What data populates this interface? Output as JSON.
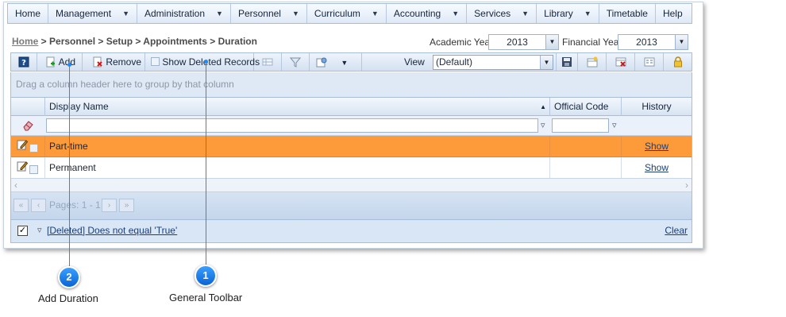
{
  "menu": [
    {
      "label": "Home",
      "dropdown": false
    },
    {
      "label": "Management",
      "dropdown": true
    },
    {
      "label": "Administration",
      "dropdown": true
    },
    {
      "label": "Personnel",
      "dropdown": true
    },
    {
      "label": "Curriculum",
      "dropdown": true
    },
    {
      "label": "Accounting",
      "dropdown": true
    },
    {
      "label": "Services",
      "dropdown": true
    },
    {
      "label": "Library",
      "dropdown": true
    },
    {
      "label": "Timetable",
      "dropdown": false
    },
    {
      "label": "Help",
      "dropdown": false
    }
  ],
  "breadcrumb": {
    "home": "Home",
    "rest": " > Personnel > Setup > Appointments > Duration"
  },
  "academic_year": {
    "label": "Academic Year",
    "value": "2013"
  },
  "financial_year": {
    "label": "Financial Year",
    "value": "2013"
  },
  "toolbar": {
    "add": "Add",
    "remove": "Remove",
    "show_deleted": "Show Deleted Records",
    "view_label": "View",
    "view_value": "(Default)"
  },
  "group_panel": "Drag a column header here to group by that column",
  "columns": {
    "display_name": "Display Name",
    "official_code": "Official Code",
    "history": "History"
  },
  "rows": [
    {
      "display_name": "Part-time",
      "official_code": "",
      "history": "Show",
      "selected": true
    },
    {
      "display_name": "Permanent",
      "official_code": "",
      "history": "Show",
      "selected": false
    }
  ],
  "pager": {
    "text": "Pages: 1 - 1"
  },
  "footer": {
    "filter_text": "[Deleted] Does not equal 'True'",
    "clear": "Clear"
  },
  "callouts": [
    {
      "number": "1",
      "caption": "General Toolbar"
    },
    {
      "number": "2",
      "caption": "Add Duration"
    }
  ],
  "colors": {
    "selected_row": "#fd9a3a",
    "callout": "#1a8cff",
    "header_gradient": "#d8e4f3"
  }
}
